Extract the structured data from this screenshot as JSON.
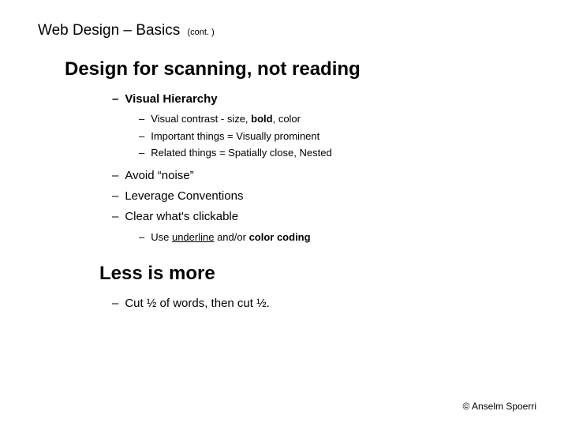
{
  "header": {
    "title": "Web Design – Basics",
    "cont": "(cont. )"
  },
  "section1": {
    "title": "Design for scanning, not reading",
    "bullets": {
      "b1": {
        "label": "Visual Hierarchy",
        "sub": {
          "s1a": "Visual contrast - size, ",
          "s1b": "bold",
          "s1c": ", color",
          "s2a": "Important things = ",
          "s2b": "Visually prominent",
          "s3a": "Related things = ",
          "s3b": "Spatially close, Nested"
        }
      },
      "b2": "Avoid “noise”",
      "b3": "Leverage Conventions",
      "b4": {
        "label": "Clear what's clickable",
        "sub": {
          "a": "Use ",
          "b": "underline",
          "c": " and/or ",
          "d": "color coding"
        }
      }
    }
  },
  "section2": {
    "title": "Less is more",
    "bullet": "Cut ½ of words, then cut ½."
  },
  "footer": "© Anselm Spoerri",
  "dash": "–"
}
